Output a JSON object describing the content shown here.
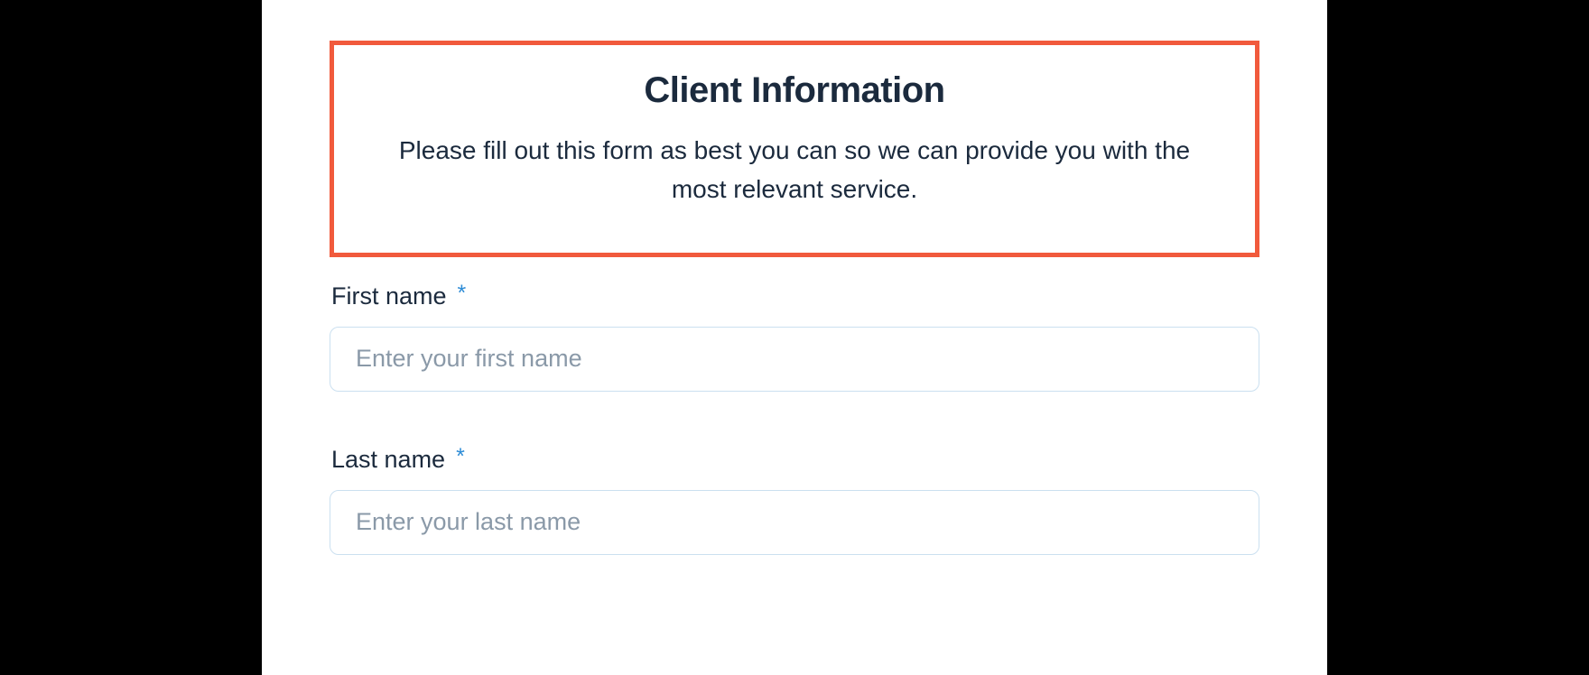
{
  "header": {
    "title": "Client Information",
    "description": "Please fill out this form as best you can so we can provide you with the most relevant service."
  },
  "fields": {
    "first_name": {
      "label": "First name",
      "required_marker": "*",
      "placeholder": "Enter your first name",
      "value": ""
    },
    "last_name": {
      "label": "Last name",
      "required_marker": "*",
      "placeholder": "Enter your last name",
      "value": ""
    }
  }
}
